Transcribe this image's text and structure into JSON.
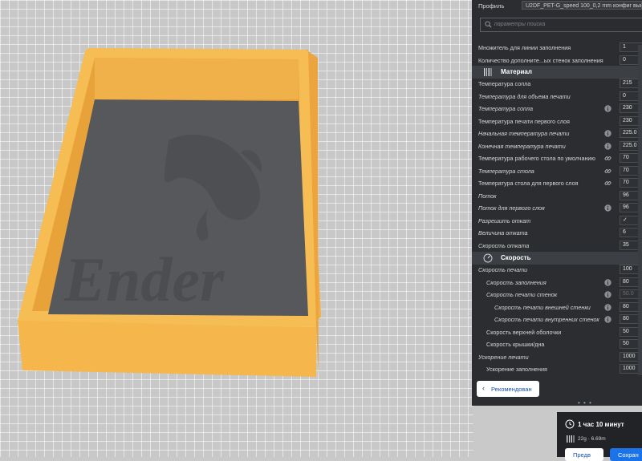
{
  "profile": {
    "label": "Профиль",
    "value": "U2DF_PET-G_speed 100_0,2 mm конфиг выкл"
  },
  "search": {
    "placeholder": "параметры поиска"
  },
  "settings_top": [
    {
      "label": "Множитель для линии заполнения",
      "value": "1"
    },
    {
      "label": "Количество дополните...ых стенок заполнения",
      "value": "0"
    }
  ],
  "section_material": {
    "title": "Материал",
    "icon": "material-icon"
  },
  "material_rows": [
    {
      "label": "Температура сопла",
      "value": "215",
      "italic": false,
      "icon": ""
    },
    {
      "label": "Температура для объема печати",
      "value": "0",
      "italic": true,
      "icon": ""
    },
    {
      "label": "Температура сопла",
      "value": "230",
      "italic": true,
      "icon": "info-icon"
    },
    {
      "label": "Температура печати первого слоя",
      "value": "230",
      "italic": false,
      "icon": ""
    },
    {
      "label": "Начальная температура печати",
      "value": "225.0",
      "italic": true,
      "icon": "info-icon"
    },
    {
      "label": "Конечная температура печати",
      "value": "225.0",
      "italic": true,
      "icon": "info-icon"
    },
    {
      "label": "Температура рабочего стола по умолчанию",
      "value": "70",
      "italic": false,
      "icon": "link-icon"
    },
    {
      "label": "Температура стола",
      "value": "70",
      "italic": true,
      "icon": "link-icon"
    },
    {
      "label": "Температура стола для первого слоя",
      "value": "70",
      "italic": false,
      "icon": "link-icon"
    },
    {
      "label": "Поток",
      "value": "96",
      "italic": true,
      "icon": ""
    },
    {
      "label": "Поток для первого слоя",
      "value": "96",
      "italic": true,
      "icon": "info-icon"
    },
    {
      "label": "Разрешить откат",
      "value": "✓",
      "italic": true,
      "icon": ""
    },
    {
      "label": "Величина отката",
      "value": "6",
      "italic": true,
      "icon": ""
    },
    {
      "label": "Скорость отката",
      "value": "35",
      "italic": true,
      "icon": ""
    }
  ],
  "section_speed": {
    "title": "Скорость",
    "icon": "speed-icon"
  },
  "speed_rows": [
    {
      "label": "Скорость печати",
      "value": "100",
      "italic": true,
      "icon": "",
      "indent": 0,
      "dim": false
    },
    {
      "label": "Скорость заполнения",
      "value": "80",
      "italic": true,
      "icon": "info-icon",
      "indent": 1,
      "dim": false
    },
    {
      "label": "Скорость печати стенок",
      "value": "50.0",
      "italic": true,
      "icon": "info-icon",
      "indent": 1,
      "dim": true
    },
    {
      "label": "Скорость печати внешней стенки",
      "value": "80",
      "italic": true,
      "icon": "info-icon",
      "indent": 2,
      "dim": false
    },
    {
      "label": "Скорость печати внутренних стенок",
      "value": "80",
      "italic": true,
      "icon": "info-icon",
      "indent": 2,
      "dim": false
    },
    {
      "label": "Скорость верхней оболочки",
      "value": "50",
      "italic": false,
      "icon": "",
      "indent": 1,
      "dim": false
    },
    {
      "label": "Скорость крышки/дна",
      "value": "50",
      "italic": false,
      "icon": "",
      "indent": 1,
      "dim": false
    },
    {
      "label": "Ускорение печати",
      "value": "1000",
      "italic": true,
      "icon": "",
      "indent": 0,
      "dim": false
    },
    {
      "label": "Ускорение заполнения",
      "value": "1000",
      "italic": false,
      "icon": "",
      "indent": 1,
      "dim": false
    }
  ],
  "recommended_button": {
    "label": "Рекомендован"
  },
  "estimate": {
    "time": "1 час 10 минут",
    "filament": "22g · 6.69m"
  },
  "preview_button": {
    "label": "Предв"
  },
  "save_button": {
    "label": "Сохран"
  },
  "model": {
    "watermark": "Ender"
  },
  "colors": {
    "model": "#f5b64c",
    "model_dark": "#d99a34",
    "inner": "#55575a",
    "panel": "#2b2d30",
    "accent": "#1a73e8"
  }
}
